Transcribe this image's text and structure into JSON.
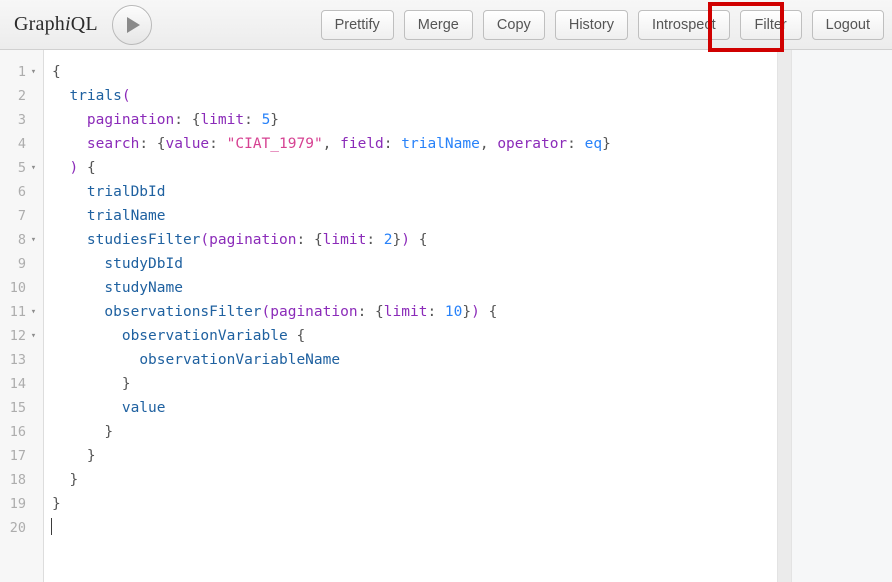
{
  "app": {
    "logo_prefix": "Graph",
    "logo_italic": "i",
    "logo_suffix": "QL"
  },
  "toolbar": {
    "run_button_label": "▶",
    "buttons": [
      {
        "label": "Prettify",
        "name": "prettify-button"
      },
      {
        "label": "Merge",
        "name": "merge-button"
      },
      {
        "label": "Copy",
        "name": "copy-button"
      },
      {
        "label": "History",
        "name": "history-button"
      },
      {
        "label": "Introspect",
        "name": "introspect-button"
      },
      {
        "label": "Filter",
        "name": "filter-button"
      },
      {
        "label": "Logout",
        "name": "logout-button"
      }
    ],
    "highlighted_button": "Filter",
    "highlight_color": "#d00000"
  },
  "editor": {
    "line_count": 20,
    "fold_lines": [
      1,
      5,
      8,
      11,
      12
    ],
    "fold_glyph": "▾",
    "cursor_line": 20,
    "line_numbers": [
      "1",
      "2",
      "3",
      "4",
      "5",
      "6",
      "7",
      "8",
      "9",
      "10",
      "11",
      "12",
      "13",
      "14",
      "15",
      "16",
      "17",
      "18",
      "19",
      "20"
    ],
    "lines": [
      {
        "n": 1,
        "text": "{"
      },
      {
        "n": 2,
        "text": "  trials("
      },
      {
        "n": 3,
        "text": "    pagination: {limit: 5}"
      },
      {
        "n": 4,
        "text": "    search: {value: \"CIAT_1979\", field: trialName, operator: eq}"
      },
      {
        "n": 5,
        "text": "  ) {"
      },
      {
        "n": 6,
        "text": "    trialDbId"
      },
      {
        "n": 7,
        "text": "    trialName"
      },
      {
        "n": 8,
        "text": "    studiesFilter(pagination: {limit: 2}) {"
      },
      {
        "n": 9,
        "text": "      studyDbId"
      },
      {
        "n": 10,
        "text": "      studyName"
      },
      {
        "n": 11,
        "text": "      observationsFilter(pagination: {limit: 10}) {"
      },
      {
        "n": 12,
        "text": "        observationVariable {"
      },
      {
        "n": 13,
        "text": "          observationVariableName"
      },
      {
        "n": 14,
        "text": "        }"
      },
      {
        "n": 15,
        "text": "        value"
      },
      {
        "n": 16,
        "text": "      }"
      },
      {
        "n": 17,
        "text": "    }"
      },
      {
        "n": 18,
        "text": "  }"
      },
      {
        "n": 19,
        "text": "}"
      },
      {
        "n": 20,
        "text": ""
      }
    ],
    "query_values": {
      "trials_pagination_limit": 5,
      "search_value": "CIAT_1979",
      "search_field": "trialName",
      "search_operator": "eq",
      "studiesFilter_limit": 2,
      "observationsFilter_limit": 10
    },
    "colors": {
      "field": "#1f61a0",
      "argument": "#8b2bb9",
      "number": "#2882f9",
      "string": "#d64292",
      "enum": "#2882f9",
      "punctuation": "#555555"
    }
  },
  "result_panel": {
    "content": ""
  }
}
